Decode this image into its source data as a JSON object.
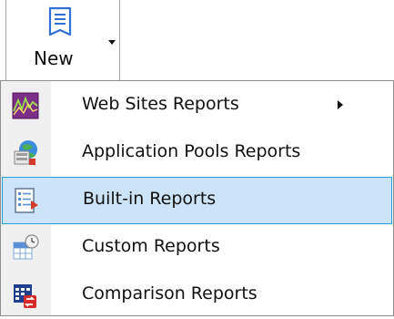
{
  "toolbar": {
    "new_label": "New"
  },
  "menu": {
    "items": [
      {
        "label": "Web Sites Reports",
        "icon": "web-sites-report-icon",
        "has_submenu": true
      },
      {
        "label": "Application Pools Reports",
        "icon": "application-pools-report-icon",
        "has_submenu": false
      },
      {
        "label": "Built-in Reports",
        "icon": "built-in-report-icon",
        "has_submenu": false,
        "highlighted": true
      },
      {
        "label": "Custom Reports",
        "icon": "custom-report-icon",
        "has_submenu": false
      },
      {
        "label": "Comparison Reports",
        "icon": "comparison-report-icon",
        "has_submenu": false
      }
    ]
  },
  "colors": {
    "highlight_bg": "#cce4f7",
    "highlight_border": "#26a0da",
    "accent_blue": "#2f6fd6"
  }
}
